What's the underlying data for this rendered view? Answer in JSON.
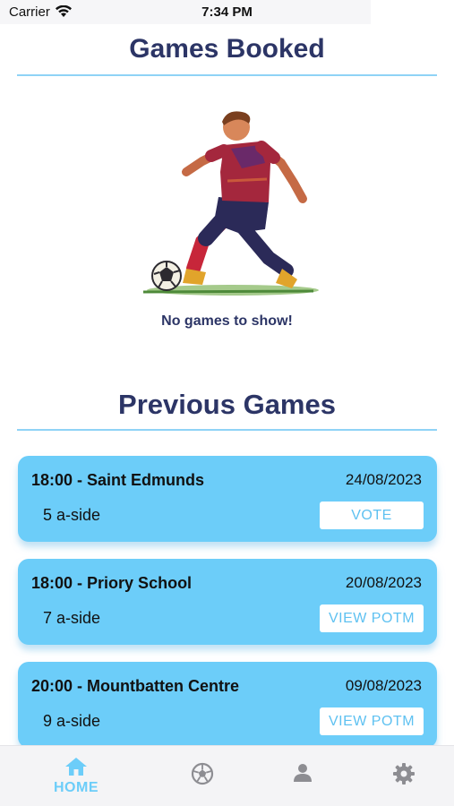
{
  "status_bar": {
    "carrier": "Carrier",
    "time": "7:34 PM"
  },
  "booked": {
    "title": "Games Booked",
    "empty_message": "No games to show!",
    "illustration": "footballer-illustration"
  },
  "previous": {
    "title": "Previous Games",
    "games": [
      {
        "title": "18:00 - Saint Edmunds",
        "date": "24/08/2023",
        "size": "5 a-side",
        "action": "VOTE"
      },
      {
        "title": "18:00 - Priory School",
        "date": "20/08/2023",
        "size": "7 a-side",
        "action": "VIEW POTM"
      },
      {
        "title": "20:00 - Mountbatten Centre",
        "date": "09/08/2023",
        "size": "9 a-side",
        "action": "VIEW POTM"
      }
    ]
  },
  "tab_bar": {
    "active": "home",
    "tabs": [
      {
        "id": "home",
        "label": "HOME",
        "icon": "home-icon"
      },
      {
        "id": "games",
        "label": "",
        "icon": "soccer-ball-icon"
      },
      {
        "id": "profile",
        "label": "",
        "icon": "user-icon"
      },
      {
        "id": "settings",
        "label": "",
        "icon": "gear-icon"
      }
    ]
  },
  "colors": {
    "accent": "#6ccdf9",
    "title": "#2c3566",
    "card": "#6ccdf9",
    "divider": "#8fd3f6"
  }
}
